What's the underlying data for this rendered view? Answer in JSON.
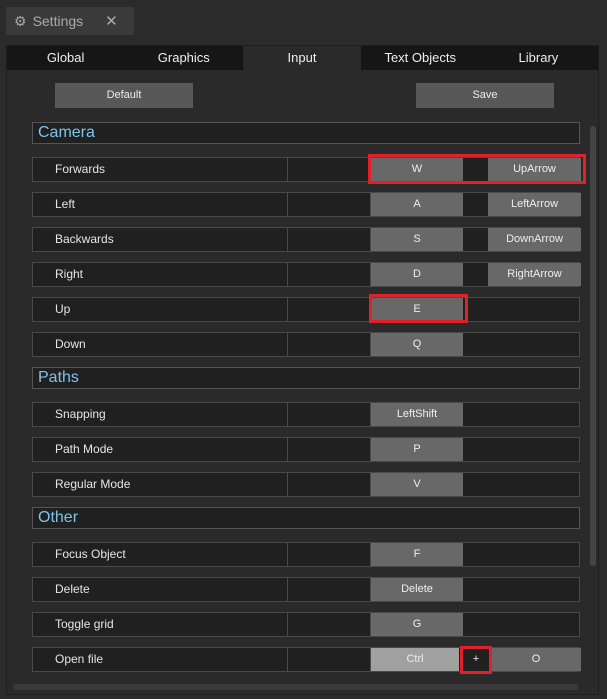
{
  "window": {
    "title": "Settings",
    "icon": "gear-icon",
    "close": "✕"
  },
  "tabs": [
    {
      "label": "Global"
    },
    {
      "label": "Graphics"
    },
    {
      "label": "Input",
      "active": true
    },
    {
      "label": "Text Objects"
    },
    {
      "label": "Library"
    }
  ],
  "buttons": {
    "default": "Default",
    "save": "Save"
  },
  "sections": [
    {
      "title": "Camera",
      "rows": [
        {
          "label": "Forwards",
          "key1": "W",
          "key2": "UpArrow",
          "highlight": "both"
        },
        {
          "label": "Left",
          "key1": "A",
          "key2": "LeftArrow"
        },
        {
          "label": "Backwards",
          "key1": "S",
          "key2": "DownArrow"
        },
        {
          "label": "Right",
          "key1": "D",
          "key2": "RightArrow"
        },
        {
          "label": "Up",
          "key1": "E",
          "highlight": "key1"
        },
        {
          "label": "Down",
          "key1": "Q"
        }
      ]
    },
    {
      "title": "Paths",
      "rows": [
        {
          "label": "Snapping",
          "key1": "LeftShift"
        },
        {
          "label": "Path Mode",
          "key1": "P"
        },
        {
          "label": "Regular Mode",
          "key1": "V"
        }
      ]
    },
    {
      "title": "Other",
      "rows": [
        {
          "label": "Focus Object",
          "key1": "F"
        },
        {
          "label": "Delete",
          "key1": "Delete"
        },
        {
          "label": "Toggle grid",
          "key1": "G"
        },
        {
          "label": "Open file",
          "modifier": "Ctrl",
          "plus": "+",
          "key1": "O",
          "highlight": "plus"
        }
      ]
    }
  ],
  "colors": {
    "accent": "#7ec3ea",
    "highlight": "#e0202a"
  }
}
